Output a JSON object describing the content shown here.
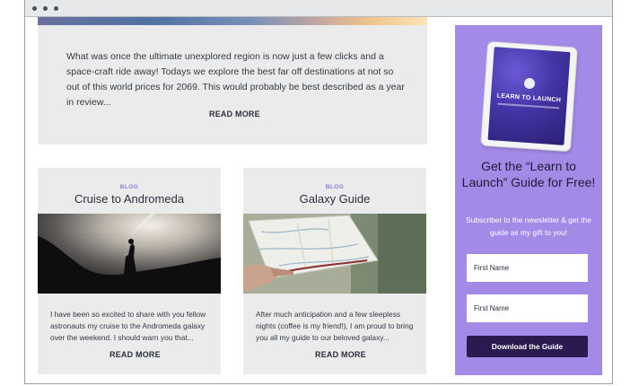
{
  "hero": {
    "excerpt": "What was once the ultimate unexplored region is now just a few clicks and a space-craft ride away! Todays we explore the best far off destinations at not so out of this world prices for 2069. This would probably be best described as a year in review...",
    "read_more": "READ MORE"
  },
  "posts": [
    {
      "tag": "BLOG",
      "title": "Cruise to Andromeda",
      "excerpt": "I have been so excited to share with you fellow astronauts my cruise to the Andromeda galaxy over the weekend. I should warn you that...",
      "read_more": "READ MORE"
    },
    {
      "tag": "BLOG",
      "title": "Galaxy Guide",
      "excerpt": "After much anticipation and a few sleepless nights (coffee is my friend!), I am proud to bring you all my guide to our beloved galaxy...",
      "read_more": "READ MORE"
    }
  ],
  "sidebar": {
    "tablet_title": "LEARN TO LAUNCH",
    "heading": "Get the “Learn to Launch” Guide for Free!",
    "subtext": "Subscriber to the newsletter & get the guide as my gift to you!",
    "first_name_placeholder_1": "First Name",
    "first_name_placeholder_2": "First Name",
    "button_label": "Download the Guide"
  },
  "colors": {
    "accent": "#a38ae6",
    "button": "#2a1a4f",
    "card_bg": "#ebebeb"
  }
}
